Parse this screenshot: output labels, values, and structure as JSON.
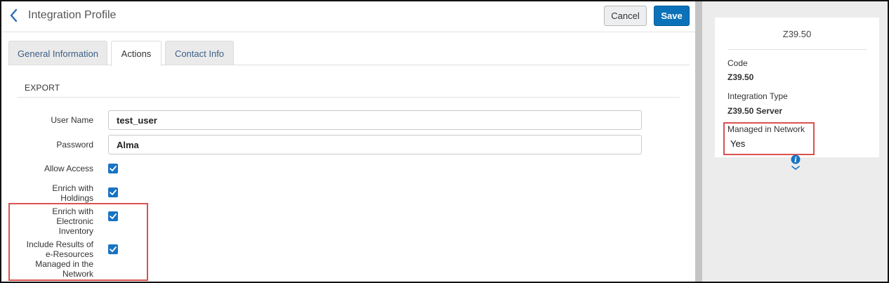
{
  "header": {
    "title": "Integration Profile",
    "cancel_label": "Cancel",
    "save_label": "Save"
  },
  "tabs": [
    {
      "label": "General Information",
      "active": false
    },
    {
      "label": "Actions",
      "active": true
    },
    {
      "label": "Contact Info",
      "active": false
    }
  ],
  "export": {
    "section_title": "EXPORT",
    "user_name_label": "User Name",
    "user_name_value": "test_user",
    "password_label": "Password",
    "password_value": "Alma",
    "allow_access_label": "Allow Access",
    "allow_access_checked": true,
    "enrich_holdings_label_1": "Enrich with",
    "enrich_holdings_label_2": "Holdings",
    "enrich_holdings_checked": true,
    "enrich_electronic_label_1": "Enrich with",
    "enrich_electronic_label_2": "Electronic",
    "enrich_electronic_label_3": "Inventory",
    "enrich_electronic_checked": true,
    "include_results_label_1": "Include Results of",
    "include_results_label_2": "e-Resources",
    "include_results_label_3": "Managed in the",
    "include_results_label_4": "Network",
    "include_results_checked": true
  },
  "summary": {
    "title": "Z39.50",
    "code_label": "Code",
    "code_value": "Z39.50",
    "integration_type_label": "Integration Type",
    "integration_type_value": "Z39.50 Server",
    "managed_label": "Managed in Network",
    "managed_value": "Yes"
  },
  "colors": {
    "accent": "#0b72b9",
    "checkbox": "#1873c3",
    "highlight": "#d9534f"
  },
  "icons": {
    "back": "chevron-left-icon",
    "checkbox": "checkmark-icon",
    "info": "info-icon"
  }
}
